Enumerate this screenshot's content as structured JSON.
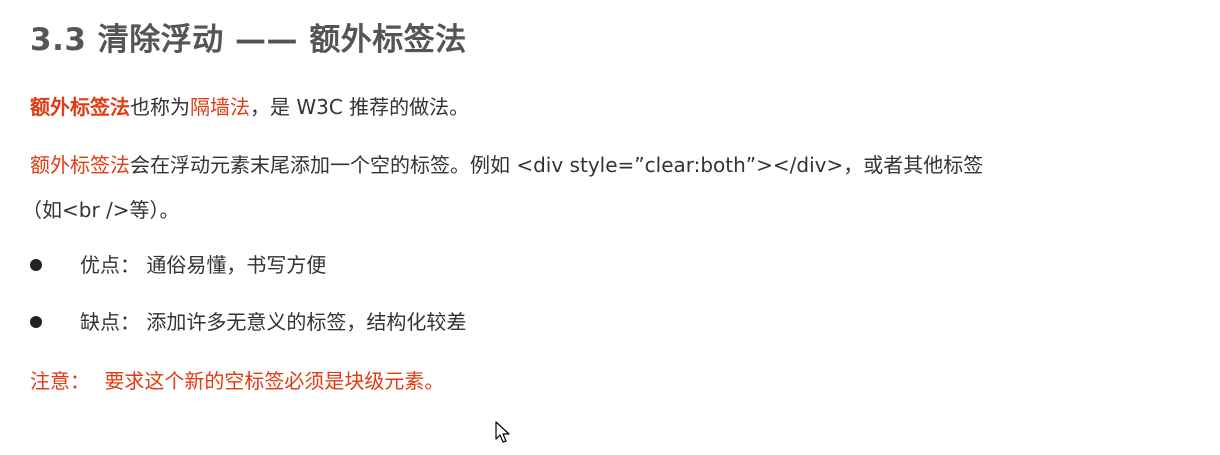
{
  "title": "3.3 清除浮动 —— 额外标签法",
  "para1": {
    "term": "额外标签法",
    "text1": "也称为",
    "term2": "隔墙法",
    "text2": "，是 W3C 推荐的做法。"
  },
  "para2": {
    "term": "额外标签法",
    "text_line1": "会在浮动元素末尾添加一个空的标签。例如 <div style=”clear:both”></div>，或者其他标签",
    "text_line2": "（如<br />等）。"
  },
  "bullets": [
    {
      "text": "优点：  通俗易懂，书写方便"
    },
    {
      "text": "缺点：  添加许多无意义的标签，结构化较差"
    }
  ],
  "note": {
    "label": "注意：",
    "text": "要求这个新的空标签必须是块级元素。"
  },
  "colors": {
    "accent": "#e23b12",
    "title": "#555555",
    "body": "#333333"
  },
  "icons": {
    "bullet": "bullet-dot-icon",
    "cursor": "mouse-pointer-icon"
  }
}
